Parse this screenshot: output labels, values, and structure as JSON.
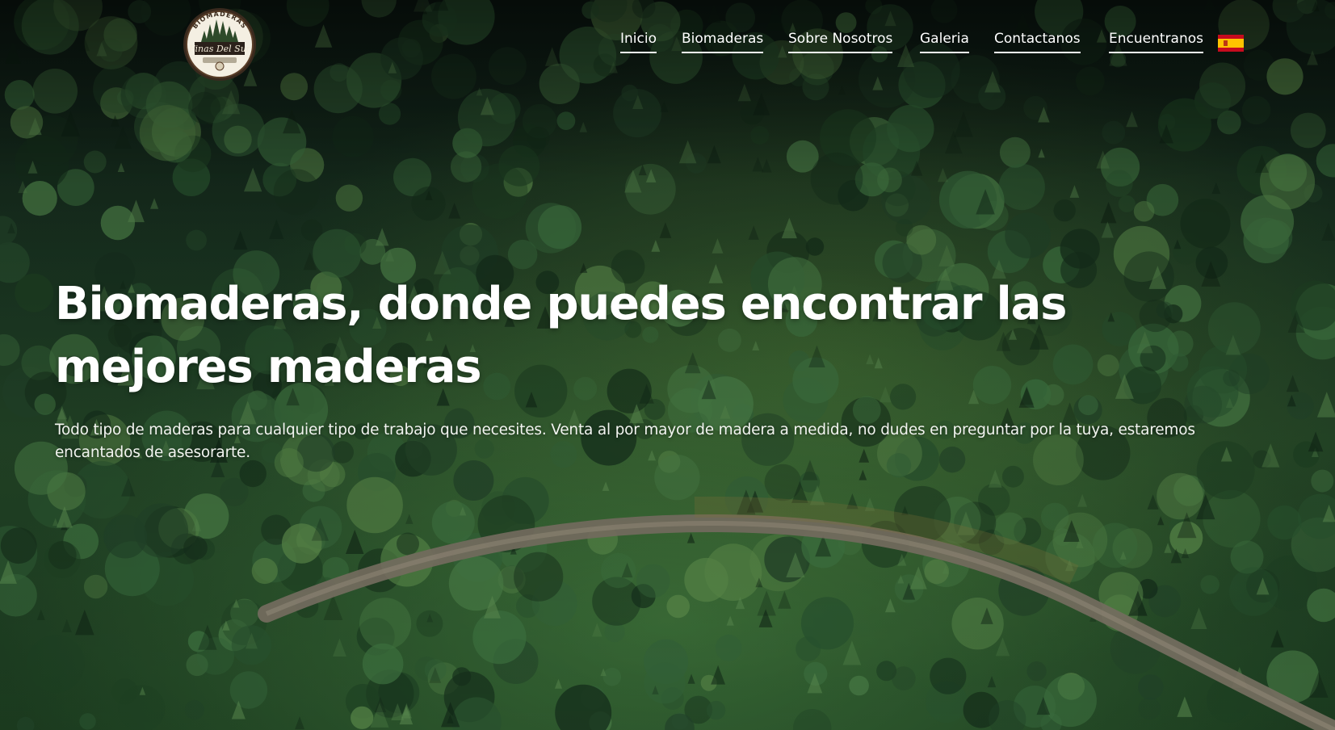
{
  "logo": {
    "top_text": "BIOMADERAS",
    "script_text": "Finas Del Sur"
  },
  "nav": {
    "items": [
      {
        "label": "Inicio"
      },
      {
        "label": "Biomaderas"
      },
      {
        "label": "Sobre Nosotros"
      },
      {
        "label": "Galeria"
      },
      {
        "label": "Contactanos"
      },
      {
        "label": "Encuentranos"
      }
    ],
    "language_flag_icon": "spain-flag-icon"
  },
  "hero": {
    "title": "Biomaderas, donde puedes encontrar las mejores maderas",
    "subtitle": "Todo tipo de maderas para cualquier tipo de trabajo que necesites. Venta al por mayor de madera a medida, no dudes en preguntar por la tuya, estaremos encantados de asesorarte."
  },
  "colors": {
    "text": "#ffffff",
    "forest_dark": "#0b1a12",
    "forest_green": "#2f5a2e",
    "road": "#8e8476",
    "flag_red": "#c60b1e",
    "flag_yellow": "#ffc400"
  }
}
